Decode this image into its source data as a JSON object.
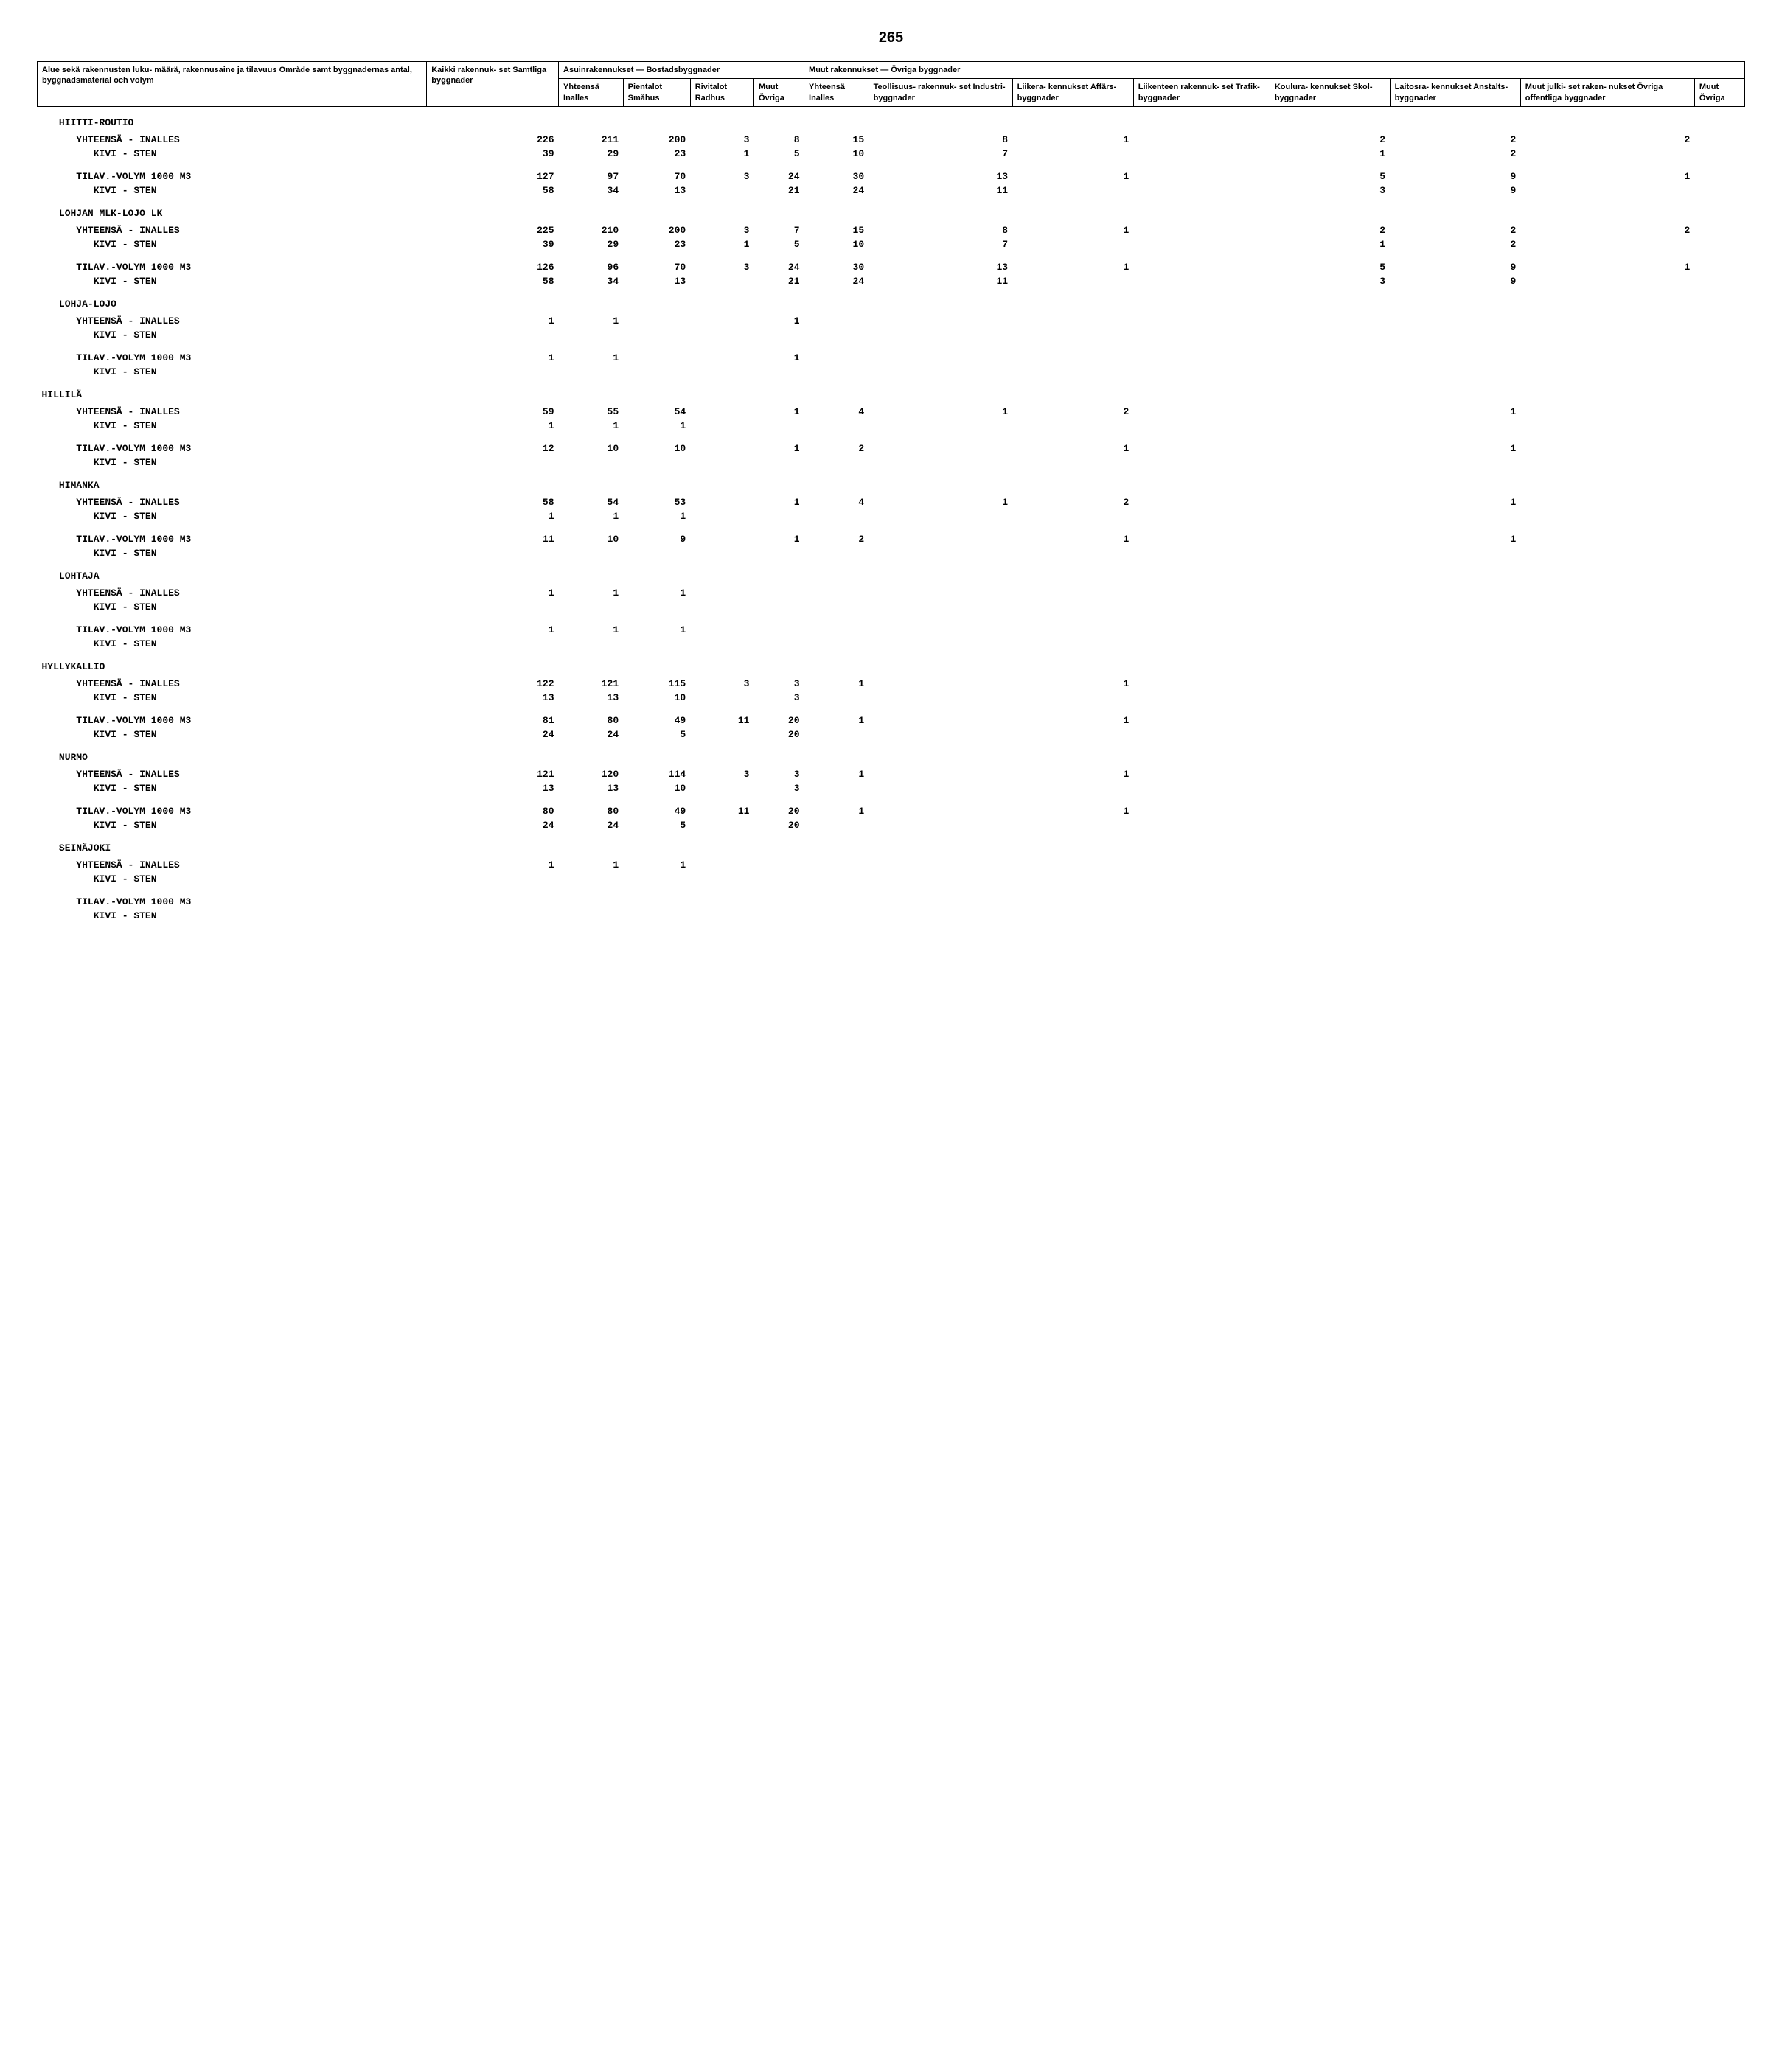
{
  "page_number": "265",
  "headers": {
    "row_header": "Alue sekä rakennusten luku-\nmäärä, rakennusaine ja\ntilavuus\nOmråde samt byggnadernas\nantal, byggnadsmaterial och\nvolym",
    "kaikki": "Kaikki\nrakennuk-\nset\nSamtliga\nbyggnader",
    "asuin_group": "Asuinrakennukset — Bostadsbyggnader",
    "asuin_yhteensa": "Yhteensä\nInalles",
    "asuin_pientalot": "Pientalot\nSmåhus",
    "asuin_rivitalot": "Rivitalot\nRadhus",
    "asuin_muut": "Muut\nÖvriga",
    "muut_group": "Muut rakennukset — Övriga byggnader",
    "muut_yhteensa": "Yhteensä\nInalles",
    "muut_teollisuus": "Teollisuus-\nrakennuk-\nset\nIndustri-\nbyggnader",
    "muut_liikera": "Liikera-\nkennukset\nAffärs-\nbyggnader",
    "muut_liikenteen": "Liikenteen\nrakennuk-\nset\nTrafik-\nbyggnader",
    "muut_koulura": "Koulura-\nkennukset\nSkol-\nbyggnader",
    "muut_laitosra": "Laitosra-\nkennukset\nAnstalts-\nbyggnader",
    "muut_julkiset": "Muut julki-\nset raken-\nnukset\nÖvriga\noffentliga\nbyggnader",
    "muut_muut": "Muut\nÖvriga"
  },
  "labels": {
    "yht": "YHTEENSÄ - INALLES",
    "kivi": "KIVI - STEN",
    "tilav": "TILAV.-VOLYM 1000 M3"
  },
  "sections": [
    {
      "name": "HIITTI-ROUTIO",
      "rows": [
        {
          "l": "yht",
          "indent": 1,
          "v": [
            "226",
            "211",
            "200",
            "3",
            "8",
            "15",
            "8",
            "1",
            "",
            "2",
            "2",
            "2",
            ""
          ]
        },
        {
          "l": "kivi",
          "indent": 2,
          "v": [
            "39",
            "29",
            "23",
            "1",
            "5",
            "10",
            "7",
            "",
            "",
            "1",
            "2",
            "",
            ""
          ]
        },
        {
          "gap": true
        },
        {
          "l": "tilav",
          "indent": 1,
          "v": [
            "127",
            "97",
            "70",
            "3",
            "24",
            "30",
            "13",
            "1",
            "",
            "5",
            "9",
            "1",
            ""
          ]
        },
        {
          "l": "kivi",
          "indent": 2,
          "v": [
            "58",
            "34",
            "13",
            "",
            "21",
            "24",
            "11",
            "",
            "",
            "3",
            "9",
            "",
            ""
          ]
        }
      ]
    },
    {
      "name": "LOHJAN MLK-LOJO LK",
      "rows": [
        {
          "l": "yht",
          "indent": 1,
          "v": [
            "225",
            "210",
            "200",
            "3",
            "7",
            "15",
            "8",
            "1",
            "",
            "2",
            "2",
            "2",
            ""
          ]
        },
        {
          "l": "kivi",
          "indent": 2,
          "v": [
            "39",
            "29",
            "23",
            "1",
            "5",
            "10",
            "7",
            "",
            "",
            "1",
            "2",
            "",
            ""
          ]
        },
        {
          "gap": true
        },
        {
          "l": "tilav",
          "indent": 1,
          "v": [
            "126",
            "96",
            "70",
            "3",
            "24",
            "30",
            "13",
            "1",
            "",
            "5",
            "9",
            "1",
            ""
          ]
        },
        {
          "l": "kivi",
          "indent": 2,
          "v": [
            "58",
            "34",
            "13",
            "",
            "21",
            "24",
            "11",
            "",
            "",
            "3",
            "9",
            "",
            ""
          ]
        }
      ]
    },
    {
      "name": "LOHJA-LOJO",
      "rows": [
        {
          "l": "yht",
          "indent": 1,
          "v": [
            "1",
            "1",
            "",
            "",
            "1",
            "",
            "",
            "",
            "",
            "",
            "",
            "",
            ""
          ]
        },
        {
          "l": "kivi",
          "indent": 2,
          "v": [
            "",
            "",
            "",
            "",
            "",
            "",
            "",
            "",
            "",
            "",
            "",
            "",
            ""
          ]
        },
        {
          "gap": true
        },
        {
          "l": "tilav",
          "indent": 1,
          "v": [
            "1",
            "1",
            "",
            "",
            "1",
            "",
            "",
            "",
            "",
            "",
            "",
            "",
            ""
          ]
        },
        {
          "l": "kivi",
          "indent": 2,
          "v": [
            "",
            "",
            "",
            "",
            "",
            "",
            "",
            "",
            "",
            "",
            "",
            "",
            ""
          ]
        }
      ]
    },
    {
      "name": "HILLILÄ",
      "level": 0,
      "rows": [
        {
          "l": "yht",
          "indent": 1,
          "v": [
            "59",
            "55",
            "54",
            "",
            "1",
            "4",
            "1",
            "2",
            "",
            "",
            "1",
            "",
            ""
          ]
        },
        {
          "l": "kivi",
          "indent": 2,
          "v": [
            "1",
            "1",
            "1",
            "",
            "",
            "",
            "",
            "",
            "",
            "",
            "",
            "",
            ""
          ]
        },
        {
          "gap": true
        },
        {
          "l": "tilav",
          "indent": 1,
          "v": [
            "12",
            "10",
            "10",
            "",
            "1",
            "2",
            "",
            "1",
            "",
            "",
            "1",
            "",
            ""
          ]
        },
        {
          "l": "kivi",
          "indent": 2,
          "v": [
            "",
            "",
            "",
            "",
            "",
            "",
            "",
            "",
            "",
            "",
            "",
            "",
            ""
          ]
        }
      ]
    },
    {
      "name": "HIMANKA",
      "rows": [
        {
          "l": "yht",
          "indent": 1,
          "v": [
            "58",
            "54",
            "53",
            "",
            "1",
            "4",
            "1",
            "2",
            "",
            "",
            "1",
            "",
            ""
          ]
        },
        {
          "l": "kivi",
          "indent": 2,
          "v": [
            "1",
            "1",
            "1",
            "",
            "",
            "",
            "",
            "",
            "",
            "",
            "",
            "",
            ""
          ]
        },
        {
          "gap": true
        },
        {
          "l": "tilav",
          "indent": 1,
          "v": [
            "11",
            "10",
            "9",
            "",
            "1",
            "2",
            "",
            "1",
            "",
            "",
            "1",
            "",
            ""
          ]
        },
        {
          "l": "kivi",
          "indent": 2,
          "v": [
            "",
            "",
            "",
            "",
            "",
            "",
            "",
            "",
            "",
            "",
            "",
            "",
            ""
          ]
        }
      ]
    },
    {
      "name": "LOHTAJA",
      "rows": [
        {
          "l": "yht",
          "indent": 1,
          "v": [
            "1",
            "1",
            "1",
            "",
            "",
            "",
            "",
            "",
            "",
            "",
            "",
            "",
            ""
          ]
        },
        {
          "l": "kivi",
          "indent": 2,
          "v": [
            "",
            "",
            "",
            "",
            "",
            "",
            "",
            "",
            "",
            "",
            "",
            "",
            ""
          ]
        },
        {
          "gap": true
        },
        {
          "l": "tilav",
          "indent": 1,
          "v": [
            "1",
            "1",
            "1",
            "",
            "",
            "",
            "",
            "",
            "",
            "",
            "",
            "",
            ""
          ]
        },
        {
          "l": "kivi",
          "indent": 2,
          "v": [
            "",
            "",
            "",
            "",
            "",
            "",
            "",
            "",
            "",
            "",
            "",
            "",
            ""
          ]
        }
      ]
    },
    {
      "name": "HYLLYKALLIO",
      "level": 0,
      "rows": [
        {
          "l": "yht",
          "indent": 1,
          "v": [
            "122",
            "121",
            "115",
            "3",
            "3",
            "1",
            "",
            "1",
            "",
            "",
            "",
            "",
            ""
          ]
        },
        {
          "l": "kivi",
          "indent": 2,
          "v": [
            "13",
            "13",
            "10",
            "",
            "3",
            "",
            "",
            "",
            "",
            "",
            "",
            "",
            ""
          ]
        },
        {
          "gap": true
        },
        {
          "l": "tilav",
          "indent": 1,
          "v": [
            "81",
            "80",
            "49",
            "11",
            "20",
            "1",
            "",
            "1",
            "",
            "",
            "",
            "",
            ""
          ]
        },
        {
          "l": "kivi",
          "indent": 2,
          "v": [
            "24",
            "24",
            "5",
            "",
            "20",
            "",
            "",
            "",
            "",
            "",
            "",
            "",
            ""
          ]
        }
      ]
    },
    {
      "name": "NURMO",
      "rows": [
        {
          "l": "yht",
          "indent": 1,
          "v": [
            "121",
            "120",
            "114",
            "3",
            "3",
            "1",
            "",
            "1",
            "",
            "",
            "",
            "",
            ""
          ]
        },
        {
          "l": "kivi",
          "indent": 2,
          "v": [
            "13",
            "13",
            "10",
            "",
            "3",
            "",
            "",
            "",
            "",
            "",
            "",
            "",
            ""
          ]
        },
        {
          "gap": true
        },
        {
          "l": "tilav",
          "indent": 1,
          "v": [
            "80",
            "80",
            "49",
            "11",
            "20",
            "1",
            "",
            "1",
            "",
            "",
            "",
            "",
            ""
          ]
        },
        {
          "l": "kivi",
          "indent": 2,
          "v": [
            "24",
            "24",
            "5",
            "",
            "20",
            "",
            "",
            "",
            "",
            "",
            "",
            "",
            ""
          ]
        }
      ]
    },
    {
      "name": "SEINÄJOKI",
      "rows": [
        {
          "l": "yht",
          "indent": 1,
          "v": [
            "1",
            "1",
            "1",
            "",
            "",
            "",
            "",
            "",
            "",
            "",
            "",
            "",
            ""
          ]
        },
        {
          "l": "kivi",
          "indent": 2,
          "v": [
            "",
            "",
            "",
            "",
            "",
            "",
            "",
            "",
            "",
            "",
            "",
            "",
            ""
          ]
        },
        {
          "gap": true
        },
        {
          "l": "tilav",
          "indent": 1,
          "v": [
            "",
            "",
            "",
            "",
            "",
            "",
            "",
            "",
            "",
            "",
            "",
            "",
            ""
          ]
        },
        {
          "l": "kivi",
          "indent": 2,
          "v": [
            "",
            "",
            "",
            "",
            "",
            "",
            "",
            "",
            "",
            "",
            "",
            "",
            ""
          ]
        }
      ]
    }
  ]
}
